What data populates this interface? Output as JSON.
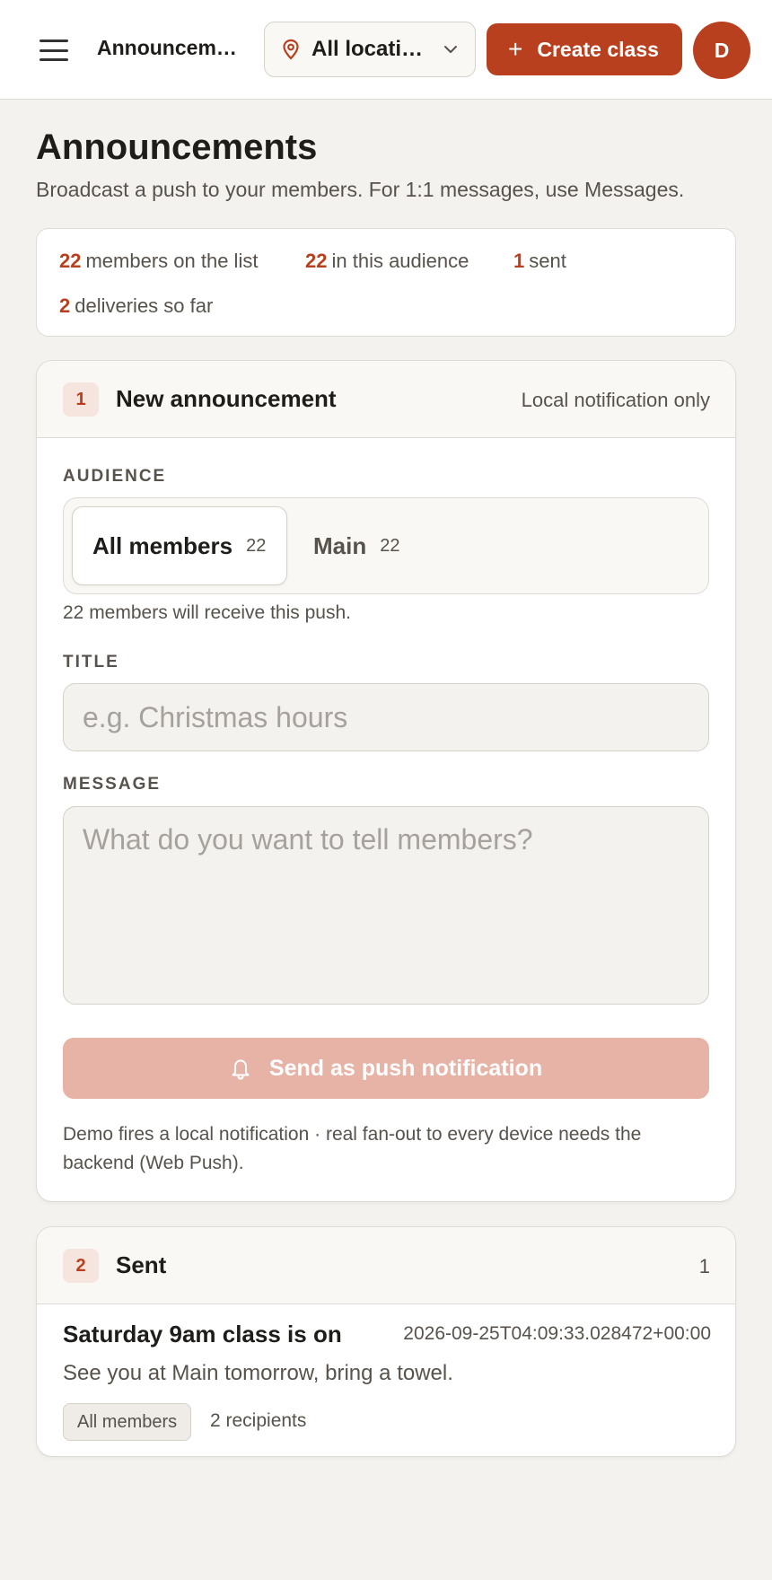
{
  "topbar": {
    "title": "Announcements",
    "location_label": "All locations",
    "create_label": "Create class",
    "avatar_initial": "D"
  },
  "header": {
    "title": "Announcements",
    "subtitle": "Broadcast a push to your members. For 1:1 messages, use Messages."
  },
  "stats": [
    {
      "value": "22",
      "label": "members on the list"
    },
    {
      "value": "22",
      "label": "in this audience"
    },
    {
      "value": "1",
      "label": "sent"
    },
    {
      "value": "2",
      "label": "deliveries so far"
    }
  ],
  "compose": {
    "step": "1",
    "title": "New announcement",
    "meta": "Local notification only",
    "audience_label": "AUDIENCE",
    "audience_options": [
      {
        "label": "All members",
        "count": "22",
        "selected": true
      },
      {
        "label": "Main",
        "count": "22",
        "selected": false
      }
    ],
    "audience_helper": "22 members will receive this push.",
    "title_label": "TITLE",
    "title_placeholder": "e.g. Christmas hours",
    "message_label": "MESSAGE",
    "message_placeholder": "What do you want to tell members?",
    "send_label": "Send as push notification",
    "note": "Demo fires a local notification · real fan-out to every device needs the backend (Web Push)."
  },
  "sent": {
    "step": "2",
    "title": "Sent",
    "count": "1",
    "items": [
      {
        "title": "Saturday 9am class is on",
        "timestamp": "2026-09-25T04:09:33.028472+00:00",
        "body": "See you at Main tomorrow, bring a towel.",
        "audience": "All members",
        "recipients": "2 recipients"
      }
    ]
  },
  "colors": {
    "accent": "#b8401f",
    "accent_disabled": "#e6b3a6",
    "background": "#f4f2ef",
    "badge_bg": "#f6e4de"
  },
  "icons": [
    "menu-icon",
    "map-pin-icon",
    "chevron-down-icon",
    "plus-icon",
    "bell-icon"
  ]
}
